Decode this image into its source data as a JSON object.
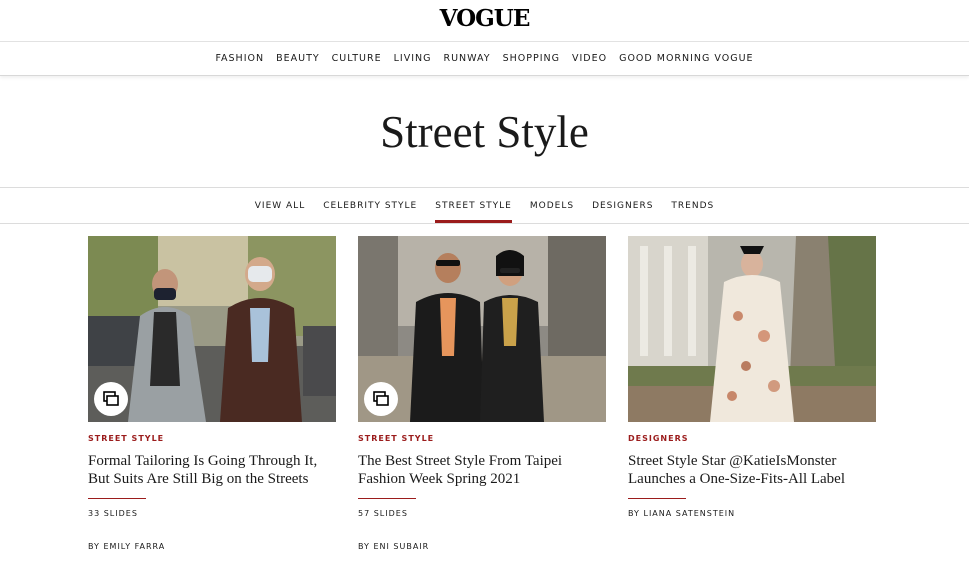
{
  "brand": {
    "logo": "VOGUE"
  },
  "main_nav": [
    "FASHION",
    "BEAUTY",
    "CULTURE",
    "LIVING",
    "RUNWAY",
    "SHOPPING",
    "VIDEO",
    "GOOD MORNING VOGUE"
  ],
  "page": {
    "title": "Street Style"
  },
  "sub_nav": {
    "items": [
      "VIEW ALL",
      "CELEBRITY STYLE",
      "STREET STYLE",
      "MODELS",
      "DESIGNERS",
      "TRENDS"
    ],
    "active": "STREET STYLE"
  },
  "cards": [
    {
      "kicker": "STREET STYLE",
      "headline": "Formal Tailoring Is Going Through It, But Suits Are Still Big on the Streets",
      "slides": "33 SLIDES",
      "byline": "BY EMILY FARRA",
      "gallery_icon": "gallery-icon"
    },
    {
      "kicker": "STREET STYLE",
      "headline": "The Best Street Style From Taipei Fashion Week Spring 2021",
      "slides": "57 SLIDES",
      "byline": "BY ENI SUBAIR",
      "gallery_icon": "gallery-icon"
    },
    {
      "kicker": "DESIGNERS",
      "headline": "Street Style Star @KatieIsMonster Launches a One-Size-Fits-All Label",
      "byline": "BY LIANA SATENSTEIN"
    }
  ],
  "colors": {
    "accent": "#9b1c1c",
    "text": "#1a1a1a",
    "divider": "#dcdcdc"
  }
}
